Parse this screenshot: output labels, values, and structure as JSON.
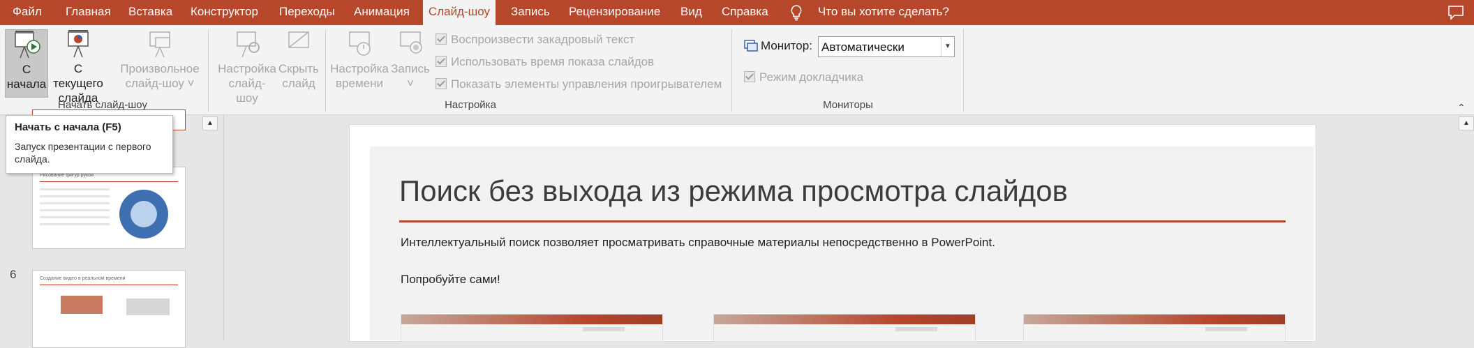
{
  "menu": {
    "tabs": [
      {
        "label": "Файл"
      },
      {
        "label": "Главная"
      },
      {
        "label": "Вставка"
      },
      {
        "label": "Конструктор"
      },
      {
        "label": "Переходы"
      },
      {
        "label": "Анимация"
      },
      {
        "label": "Слайд-шоу",
        "active": true
      },
      {
        "label": "Запись"
      },
      {
        "label": "Рецензирование"
      },
      {
        "label": "Вид"
      },
      {
        "label": "Справка"
      }
    ],
    "tell_me": "Что вы хотите сделать?"
  },
  "ribbon": {
    "start": {
      "from_beginning": [
        "С",
        "начала"
      ],
      "from_current": [
        "С текущего",
        "слайда"
      ],
      "custom": [
        "Произвольное",
        "слайд-шоу ˅"
      ],
      "group_label": "Начать слайд-шоу"
    },
    "setup": {
      "setup_show": [
        "Настройка",
        "слайд-шоу"
      ],
      "hide_slide": [
        "Скрыть",
        "слайд"
      ],
      "rehearse": [
        "Настройка",
        "времени"
      ],
      "record": [
        "Запись",
        "˅"
      ],
      "play_narrations": "Воспроизвести закадровый текст",
      "use_timings": "Использовать время показа слайдов",
      "show_media_controls": "Показать элементы управления проигрывателем",
      "group_label": "Настройка"
    },
    "monitors": {
      "monitor_label": "Монитор:",
      "monitor_value": "Автоматически",
      "presenter_view": "Режим докладчика",
      "group_label": "Мониторы"
    }
  },
  "tooltip": {
    "title": "Начать с начала (F5)",
    "body": "Запуск презентации с первого слайда."
  },
  "thumbnails": {
    "slide_number": "6",
    "slide5_title": "Рисование фигур рукой",
    "slide6_title": "Создание видео в реальном времени"
  },
  "slide": {
    "title": "Поиск без выхода из режима просмотра слайдов",
    "body": "Интеллектуальный поиск позволяет просматривать справочные материалы непосредственно в PowerPoint.",
    "cta": "Попробуйте сами!"
  },
  "colors": {
    "accent": "#b7472a",
    "ribbon_bg": "#f3f3f3",
    "workspace_bg": "#e6e6e6"
  }
}
